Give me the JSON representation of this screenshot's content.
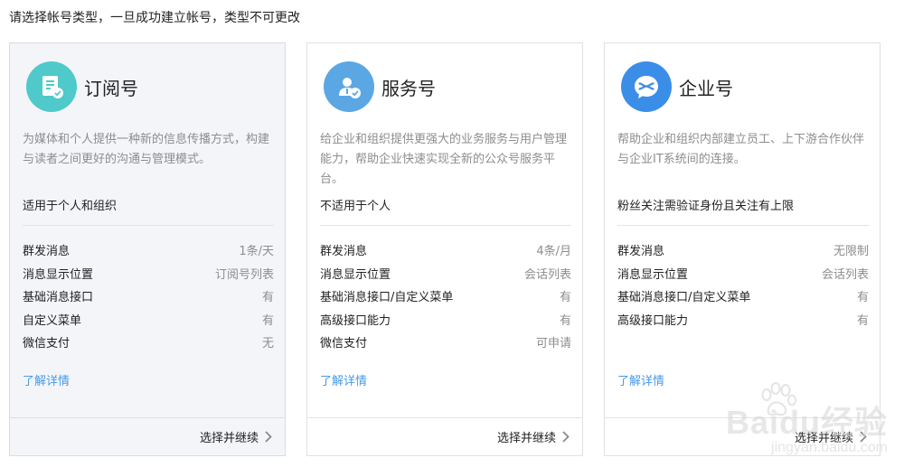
{
  "page": {
    "title": "请选择帐号类型，一旦成功建立帐号，类型不可更改"
  },
  "colors": {
    "accent_link": "#459ae9",
    "subscription_logo": "#4fc9c9",
    "service_logo": "#5aa7e4",
    "enterprise_logo": "#3b8ee8"
  },
  "cards": [
    {
      "name": "订阅号",
      "icon": "document-badge-icon",
      "description": "为媒体和个人提供一种新的信息传播方式，构建与读者之间更好的沟通与管理模式。",
      "scope": "适用于个人和组织",
      "features": [
        {
          "label": "群发消息",
          "value": "1条/天"
        },
        {
          "label": "消息显示位置",
          "value": "订阅号列表"
        },
        {
          "label": "基础消息接口",
          "value": "有"
        },
        {
          "label": "自定义菜单",
          "value": "有"
        },
        {
          "label": "微信支付",
          "value": "无"
        }
      ],
      "learn_more": "了解详情",
      "action": "选择并继续"
    },
    {
      "name": "服务号",
      "icon": "user-badge-icon",
      "description": "给企业和组织提供更强大的业务服务与用户管理能力，帮助企业快速实现全新的公众号服务平台。",
      "scope": "不适用于个人",
      "features": [
        {
          "label": "群发消息",
          "value": "4条/月"
        },
        {
          "label": "消息显示位置",
          "value": "会话列表"
        },
        {
          "label": "基础消息接口/自定义菜单",
          "value": "有"
        },
        {
          "label": "高级接口能力",
          "value": "有"
        },
        {
          "label": "微信支付",
          "value": "可申请"
        }
      ],
      "learn_more": "了解详情",
      "action": "选择并继续"
    },
    {
      "name": "企业号",
      "icon": "enterprise-bubble-icon",
      "description": "帮助企业和组织内部建立员工、上下游合作伙伴与企业IT系统间的连接。",
      "scope": "粉丝关注需验证身份且关注有上限",
      "features": [
        {
          "label": "群发消息",
          "value": "无限制"
        },
        {
          "label": "消息显示位置",
          "value": "会话列表"
        },
        {
          "label": "基础消息接口/自定义菜单",
          "value": "有"
        },
        {
          "label": "高级接口能力",
          "value": "有"
        }
      ],
      "learn_more": "了解详情",
      "action": "选择并继续"
    }
  ],
  "watermark": {
    "brand": "Baidu经验",
    "sub": "jingyan.baidu.com"
  }
}
